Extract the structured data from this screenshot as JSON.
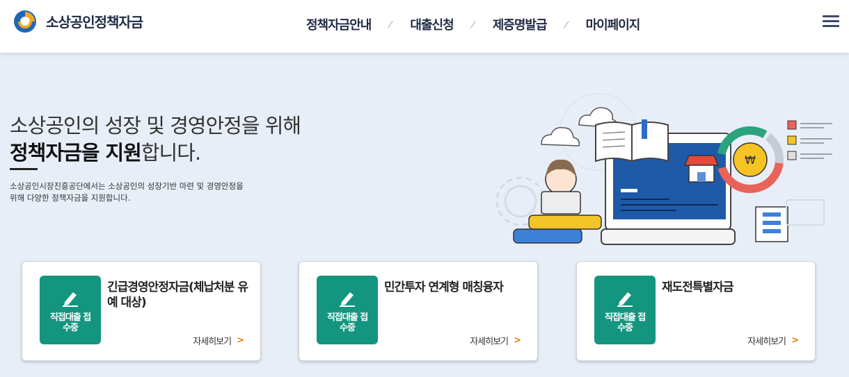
{
  "header": {
    "logo_text": "소상공인정책자금",
    "nav": [
      "정책자금안내",
      "대출신청",
      "제증명발급",
      "마이페이지"
    ],
    "menu_icon": "hamburger-menu-icon"
  },
  "hero": {
    "line1": "소상공인의 성장 및 경영안정을 위해",
    "line2_bold": "정책자금을 지원",
    "line2_rest": "합니다.",
    "description": "소상공인시장진흥공단에서는 소상공인의 성장기반 마련 및 경영안정을 위해 다양한 정책자금을 지원합니다."
  },
  "cards": [
    {
      "badge": "직접대출 접수중",
      "title": "긴급경영안정자금(체납처분 유예 대상)",
      "more": "자세히보기"
    },
    {
      "badge": "직접대출 접수중",
      "title": "민간투자 연계형 매칭융자",
      "more": "자세히보기"
    },
    {
      "badge": "직접대출 접수중",
      "title": "재도전특별자금",
      "more": "자세히보기"
    }
  ],
  "colors": {
    "badge_green": "#14957f",
    "accent_orange": "#e07b10",
    "background": "#e8eef7"
  }
}
